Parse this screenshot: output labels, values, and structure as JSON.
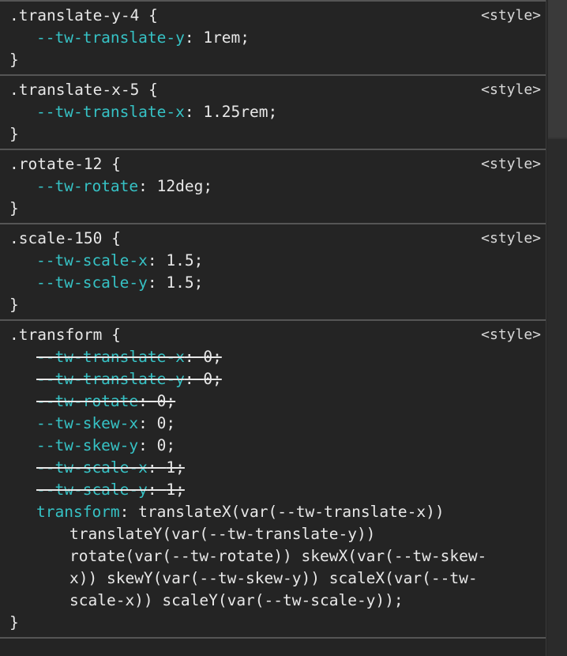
{
  "rules": [
    {
      "selector": ".translate-y-4",
      "source": "<style>",
      "decls": [
        {
          "prop": "--tw-translate-y",
          "val": "1rem;",
          "struck": false
        }
      ]
    },
    {
      "selector": ".translate-x-5",
      "source": "<style>",
      "decls": [
        {
          "prop": "--tw-translate-x",
          "val": "1.25rem;",
          "struck": false
        }
      ]
    },
    {
      "selector": ".rotate-12",
      "source": "<style>",
      "decls": [
        {
          "prop": "--tw-rotate",
          "val": "12deg;",
          "struck": false
        }
      ]
    },
    {
      "selector": ".scale-150",
      "source": "<style>",
      "decls": [
        {
          "prop": "--tw-scale-x",
          "val": "1.5;",
          "struck": false
        },
        {
          "prop": "--tw-scale-y",
          "val": "1.5;",
          "struck": false
        }
      ]
    },
    {
      "selector": ".transform",
      "source": "<style>",
      "decls": [
        {
          "prop": "--tw-translate-x",
          "val": "0;",
          "struck": true
        },
        {
          "prop": "--tw-translate-y",
          "val": "0;",
          "struck": true
        },
        {
          "prop": "--tw-rotate",
          "val": "0;",
          "struck": true
        },
        {
          "prop": "--tw-skew-x",
          "val": "0;",
          "struck": false
        },
        {
          "prop": "--tw-skew-y",
          "val": "0;",
          "struck": false
        },
        {
          "prop": "--tw-scale-x",
          "val": "1;",
          "struck": true
        },
        {
          "prop": "--tw-scale-y",
          "val": "1;",
          "struck": true
        }
      ],
      "transform": {
        "prop": "transform",
        "lines": [
          "translateX(var(--tw-translate-x))",
          "translateY(var(--tw-translate-y))",
          "rotate(var(--tw-rotate)) skewX(var(--tw-skew-",
          "x)) skewY(var(--tw-skew-y)) scaleX(var(--tw-",
          "scale-x)) scaleY(var(--tw-scale-y));"
        ]
      }
    }
  ],
  "brace_open": "{",
  "brace_close": "}",
  "colon": ": "
}
